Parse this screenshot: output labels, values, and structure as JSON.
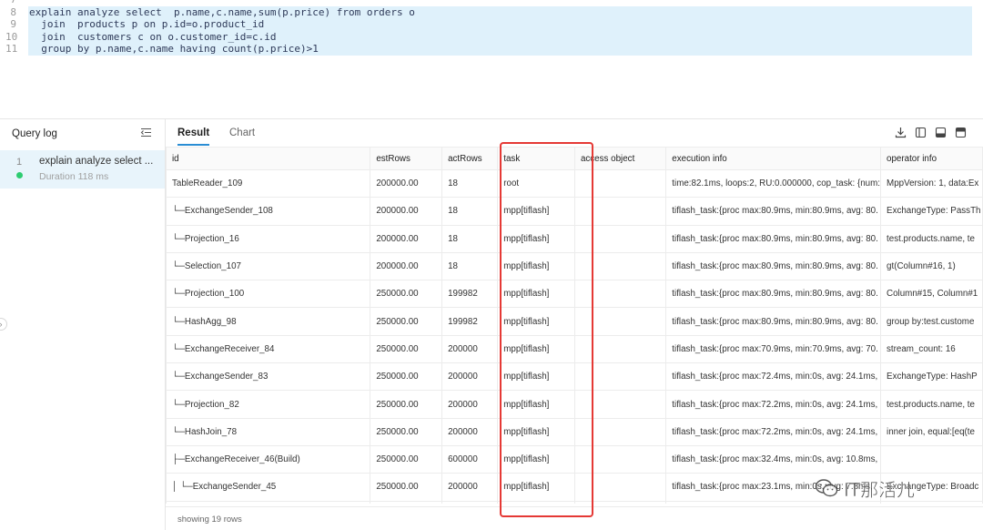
{
  "editor": {
    "lines": [
      {
        "n": "7",
        "text": "",
        "selected": false
      },
      {
        "n": "8",
        "text": "explain analyze select  p.name,c.name,sum(p.price) from orders o",
        "selected": true
      },
      {
        "n": "9",
        "text": "  join  products p on p.id=o.product_id",
        "selected": true
      },
      {
        "n": "10",
        "text": "  join  customers c on o.customer_id=c.id",
        "selected": true
      },
      {
        "n": "11",
        "text": "  group by p.name,c.name having count(p.price)>1",
        "selected": true
      }
    ]
  },
  "query_log": {
    "title": "Query log",
    "items": [
      {
        "index": "1",
        "query": "explain analyze select ...",
        "duration": "Duration 118 ms"
      }
    ]
  },
  "tabs": [
    {
      "label": "Result",
      "active": true
    },
    {
      "label": "Chart",
      "active": false
    }
  ],
  "toolbar_icons": [
    "download-icon",
    "split-columns-icon",
    "panel-bottom-icon",
    "panel-top-icon"
  ],
  "table": {
    "columns": [
      "id",
      "estRows",
      "actRows",
      "task",
      "access object",
      "execution info",
      "operator info"
    ],
    "rows": [
      [
        "TableReader_109",
        "200000.00",
        "18",
        "root",
        "",
        "time:82.1ms, loops:2, RU:0.000000, cop_task: {num:",
        "MppVersion: 1, data:Ex"
      ],
      [
        "└─ExchangeSender_108",
        "200000.00",
        "18",
        "mpp[tiflash]",
        "",
        "tiflash_task:{proc max:80.9ms, min:80.9ms, avg: 80.",
        "ExchangeType: PassTh"
      ],
      [
        "└─Projection_16",
        "200000.00",
        "18",
        "mpp[tiflash]",
        "",
        "tiflash_task:{proc max:80.9ms, min:80.9ms, avg: 80.",
        "test.products.name, te"
      ],
      [
        "└─Selection_107",
        "200000.00",
        "18",
        "mpp[tiflash]",
        "",
        "tiflash_task:{proc max:80.9ms, min:80.9ms, avg: 80.",
        "gt(Column#16, 1)"
      ],
      [
        "└─Projection_100",
        "250000.00",
        "199982",
        "mpp[tiflash]",
        "",
        "tiflash_task:{proc max:80.9ms, min:80.9ms, avg: 80.",
        "Column#15, Column#1"
      ],
      [
        "└─HashAgg_98",
        "250000.00",
        "199982",
        "mpp[tiflash]",
        "",
        "tiflash_task:{proc max:80.9ms, min:80.9ms, avg: 80.",
        "group by:test.custome"
      ],
      [
        "└─ExchangeReceiver_84",
        "250000.00",
        "200000",
        "mpp[tiflash]",
        "",
        "tiflash_task:{proc max:70.9ms, min:70.9ms, avg: 70.",
        "stream_count: 16"
      ],
      [
        "└─ExchangeSender_83",
        "250000.00",
        "200000",
        "mpp[tiflash]",
        "",
        "tiflash_task:{proc max:72.4ms, min:0s, avg: 24.1ms,",
        "ExchangeType: HashP"
      ],
      [
        "└─Projection_82",
        "250000.00",
        "200000",
        "mpp[tiflash]",
        "",
        "tiflash_task:{proc max:72.2ms, min:0s, avg: 24.1ms,",
        "test.products.name, te"
      ],
      [
        "└─HashJoin_78",
        "250000.00",
        "200000",
        "mpp[tiflash]",
        "",
        "tiflash_task:{proc max:72.2ms, min:0s, avg: 24.1ms,",
        "inner join, equal:[eq(te"
      ],
      [
        "├─ExchangeReceiver_46(Build)",
        "250000.00",
        "600000",
        "mpp[tiflash]",
        "",
        "tiflash_task:{proc max:32.4ms, min:0s, avg: 10.8ms,",
        ""
      ],
      [
        "│ └─ExchangeSender_45",
        "250000.00",
        "200000",
        "mpp[tiflash]",
        "",
        "tiflash_task:{proc max:23.1ms, min:0s, avg: 7.8ms,",
        "ExchangeType: Broadc"
      ],
      [
        "",
        "",
        "",
        "",
        "",
        "",
        ""
      ]
    ],
    "footer": "showing 19 rows"
  },
  "watermark": {
    "text": "IT那活儿"
  },
  "colors": {
    "accent": "#2a8dd4",
    "selection": "#dff1fb",
    "highlight_box": "#e53935",
    "status_ok": "#2ecc71"
  }
}
